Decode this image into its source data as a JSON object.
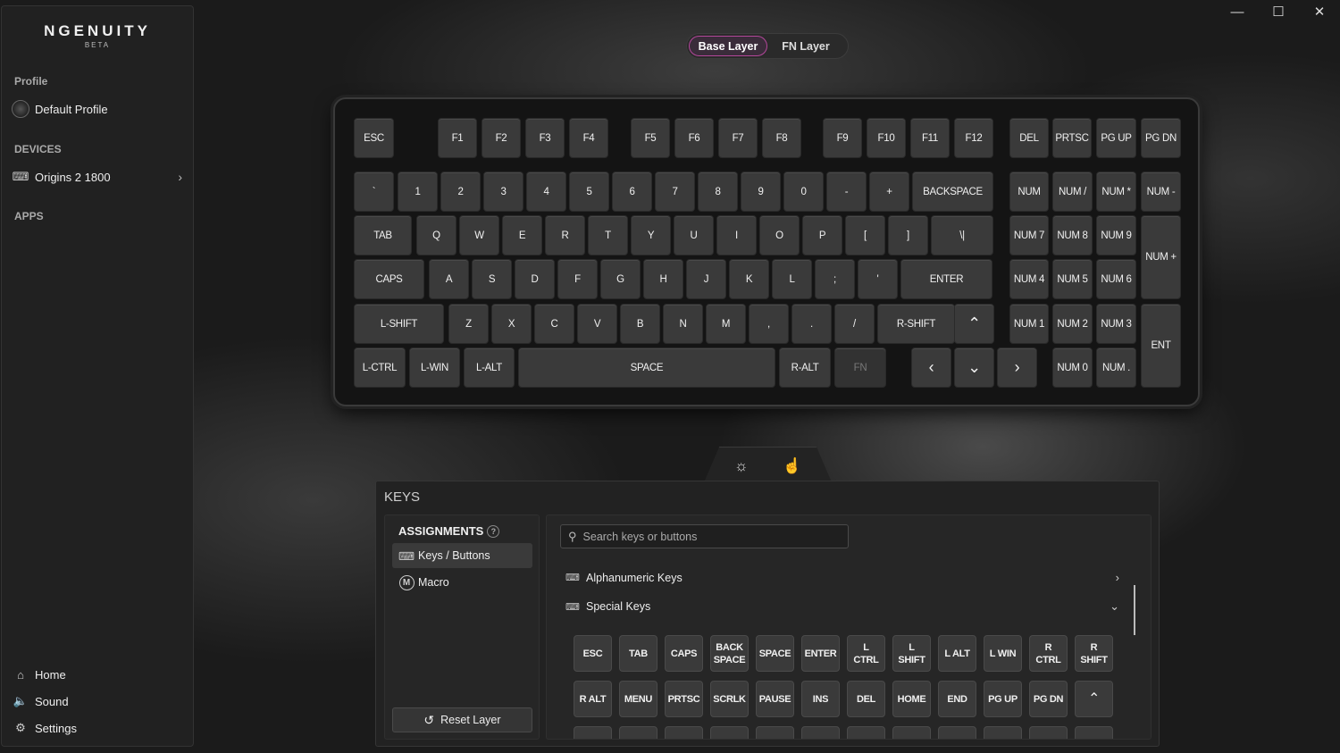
{
  "app": {
    "name": "NGENUITY",
    "subtitle": "BETA"
  },
  "window_controls": {
    "minimize": "—",
    "maximize": "☐",
    "close": "✕"
  },
  "sidebar": {
    "profile_label": "Profile",
    "profile_name": "Default Profile",
    "devices_label": "DEVICES",
    "device_name": "Origins 2 1800",
    "apps_label": "APPS",
    "bottom": {
      "home": "Home",
      "sound": "Sound",
      "settings": "Settings"
    }
  },
  "layers": {
    "base": "Base Layer",
    "fn": "FN Layer",
    "active": "base"
  },
  "keyboard": {
    "rows": [
      [
        "ESC",
        "F1",
        "F2",
        "F3",
        "F4",
        "F5",
        "F6",
        "F7",
        "F8",
        "F9",
        "F10",
        "F11",
        "F12",
        "DEL",
        "PRTSC",
        "PG UP",
        "PG DN"
      ],
      [
        "`",
        "1",
        "2",
        "3",
        "4",
        "5",
        "6",
        "7",
        "8",
        "9",
        "0",
        "-",
        "+",
        "BACKSPACE",
        "NUM",
        "NUM /",
        "NUM *",
        "NUM -"
      ],
      [
        "TAB",
        "Q",
        "W",
        "E",
        "R",
        "T",
        "Y",
        "U",
        "I",
        "O",
        "P",
        "[",
        "]",
        "\\|",
        "NUM 7",
        "NUM 8",
        "NUM 9",
        "NUM +"
      ],
      [
        "CAPS",
        "A",
        "S",
        "D",
        "F",
        "G",
        "H",
        "J",
        "K",
        "L",
        ";",
        "'",
        "ENTER",
        "NUM 4",
        "NUM 5",
        "NUM 6"
      ],
      [
        "L-SHIFT",
        "Z",
        "X",
        "C",
        "V",
        "B",
        "N",
        "M",
        ",",
        ".",
        "/",
        "R-SHIFT",
        "⌃",
        "NUM 1",
        "NUM 2",
        "NUM 3",
        "ENT"
      ],
      [
        "L-CTRL",
        "L-WIN",
        "L-ALT",
        "SPACE",
        "R-ALT",
        "FN",
        "‹",
        "⌄",
        "›",
        "NUM 0",
        "NUM ."
      ]
    ]
  },
  "panel": {
    "title": "KEYS",
    "assignments_title": "ASSIGNMENTS",
    "help": "?",
    "items": [
      {
        "label": "Keys / Buttons",
        "selected": true
      },
      {
        "label": "Macro",
        "icon_letter": "M"
      }
    ],
    "reset_label": "Reset Layer",
    "search_placeholder": "Search keys or buttons",
    "categories": [
      {
        "label": "Alphanumeric Keys",
        "state": "collapsed"
      },
      {
        "label": "Special Keys",
        "state": "expanded"
      }
    ],
    "special_keys_row1": [
      "ESC",
      "TAB",
      "CAPS",
      "BACK\nSPACE",
      "SPACE",
      "ENTER",
      "L\nCTRL",
      "L\nSHIFT",
      "L ALT",
      "L WIN",
      "R\nCTRL",
      "R\nSHIFT"
    ],
    "special_keys_row2": [
      "R ALT",
      "MENU",
      "PRTSC",
      "SCRLK",
      "PAUSE",
      "INS",
      "DEL",
      "HOME",
      "END",
      "PG UP",
      "PG DN",
      "⌃"
    ]
  },
  "colors": {
    "accent": "#b3479a",
    "key": "#3a3a3a",
    "panel": "#222222"
  }
}
